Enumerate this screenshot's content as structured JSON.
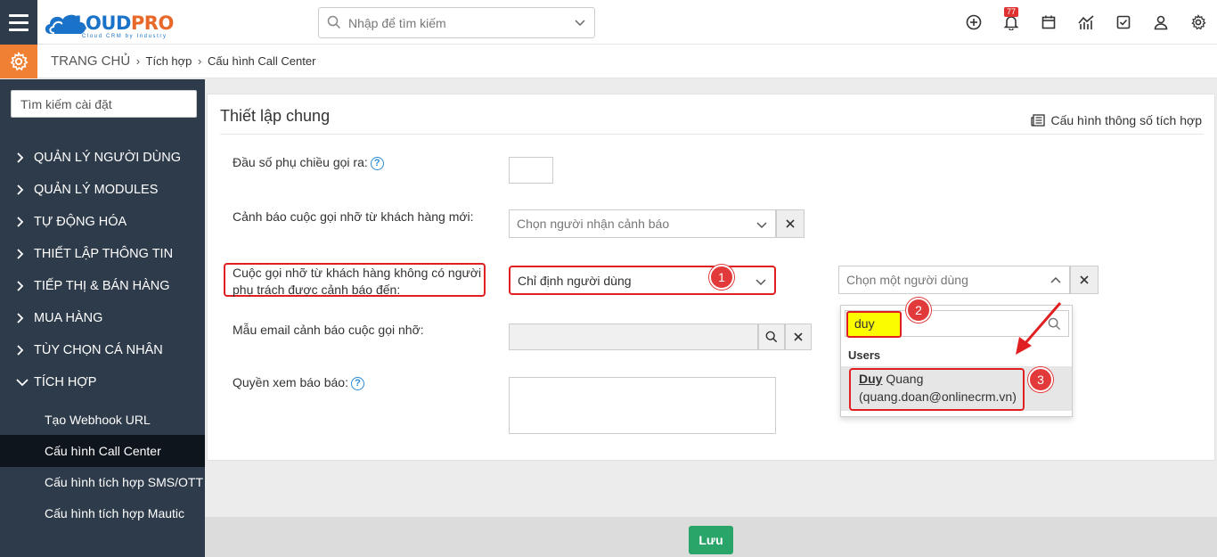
{
  "app": {
    "logo_text_1": "CLOUD",
    "logo_text_2": "PRO",
    "logo_tagline": "Cloud CRM by Industry"
  },
  "header": {
    "search_placeholder": "Nhập để tìm kiếm",
    "notification_count": "77",
    "icons": [
      "plus-circle-icon",
      "bell-icon",
      "calendar-icon",
      "chart-icon",
      "checkbox-icon",
      "user-icon",
      "gear-icon"
    ]
  },
  "breadcrumb": {
    "home": "TRANG CHỦ",
    "level1": "Tích hợp",
    "level2": "Cấu hình Call Center"
  },
  "sidebar": {
    "search_placeholder": "Tìm kiếm cài đặt",
    "items": [
      {
        "label": "QUẢN LÝ NGƯỜI DÙNG"
      },
      {
        "label": "QUẢN LÝ MODULES"
      },
      {
        "label": "TỰ ĐỘNG HÓA"
      },
      {
        "label": "THIẾT LẬP THÔNG TIN"
      },
      {
        "label": "TIẾP THỊ & BÁN HÀNG"
      },
      {
        "label": "MUA HÀNG"
      },
      {
        "label": "TÙY CHỌN CÁ NHÂN"
      },
      {
        "label": "TÍCH HỢP"
      }
    ],
    "subitems": [
      {
        "label": "Tạo Webhook URL"
      },
      {
        "label": "Cấu hình Call Center"
      },
      {
        "label": "Cấu hình tích hợp SMS/OTT"
      },
      {
        "label": "Cấu hình tích hợp Mautic"
      }
    ]
  },
  "card": {
    "title": "Thiết lập chung",
    "link": "Cấu hình thông số tích hợp"
  },
  "form": {
    "prefix_label": "Đầu số phụ chiều gọi ra:",
    "missed_call_new_label": "Cảnh báo cuộc gọi nhỡ từ khách hàng mới:",
    "missed_call_new_placeholder": "Chọn người nhận cảnh báo",
    "unassigned_label_line1": "Cuộc gọi nhỡ từ khách hàng không có người",
    "unassigned_label_line2": "phụ trách được cảnh báo đến:",
    "unassigned_value": "Chỉ định người dùng",
    "user_select_placeholder": "Chọn một người dùng",
    "email_template_label": "Mẫu email cảnh báo cuộc gọi nhỡ:",
    "report_permission_label": "Quyền xem báo báo:"
  },
  "dropdown": {
    "search_value": "duy",
    "group": "Users",
    "option_name_match": "Duy",
    "option_name_rest": " Quang",
    "option_email": "(quang.doan@onlinecrm.vn)"
  },
  "steps": [
    "1",
    "2",
    "3"
  ],
  "footer": {
    "save_label": "Lưu"
  },
  "colors": {
    "sidebar_bg": "#2e3b4a",
    "accent_orange": "#f08034",
    "save_green": "#2aa56a",
    "annotation_red": "#e02020"
  }
}
